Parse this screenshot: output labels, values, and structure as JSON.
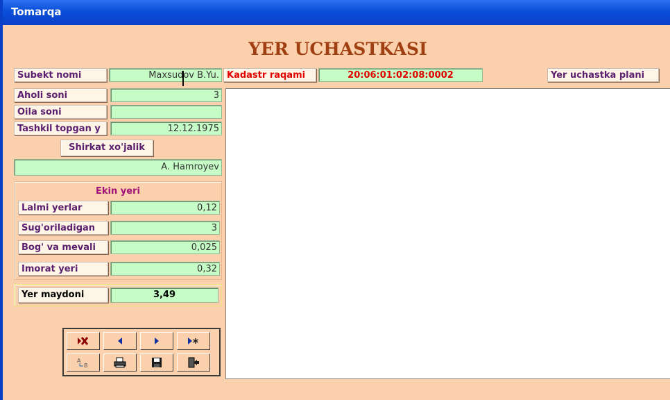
{
  "window": {
    "title": "Tomarqa"
  },
  "heading": "YER UCHASTKASI",
  "subject": {
    "label": "Subekt nomi",
    "value": "Maxsudov B.Yu."
  },
  "cadastre": {
    "label": "Kadastr raqami",
    "value": "20:06:01:02:08:0002"
  },
  "plan_label": "Yer uchastka plani",
  "fields": [
    {
      "label": "Aholi soni",
      "value": "3"
    },
    {
      "label": "Oila soni",
      "value": ""
    },
    {
      "label": "Tashkil topgan y",
      "value": "12.12.1975"
    }
  ],
  "farm": {
    "label": "Shirkat xo'jalik",
    "value": "A. Hamroyev"
  },
  "crop_area": {
    "title": "Ekin yeri",
    "rows": [
      {
        "label": "Lalmi yerlar",
        "value": "0,12"
      },
      {
        "label": "Sug'oriladigan",
        "value": "3"
      },
      {
        "label": "Bog' va mevali",
        "value": "0,025"
      },
      {
        "label": "Imorat yeri",
        "value": "0,32"
      }
    ]
  },
  "total": {
    "label": "Yer maydoni",
    "value": "3,49"
  },
  "nav_buttons": [
    {
      "icon": "delete-record-icon"
    },
    {
      "icon": "previous-record-icon"
    },
    {
      "icon": "next-record-icon"
    },
    {
      "icon": "new-record-icon"
    },
    {
      "icon": "spellcheck-icon"
    },
    {
      "icon": "print-icon"
    },
    {
      "icon": "save-icon"
    },
    {
      "icon": "exit-icon"
    }
  ],
  "colors": {
    "title_bar": "#0a4fd8",
    "form_bg": "#fbd0ac",
    "field_bg": "#c6fcc6",
    "label_text": "#5a1f6e",
    "accent": "#e00000",
    "heading": "#a04012"
  }
}
